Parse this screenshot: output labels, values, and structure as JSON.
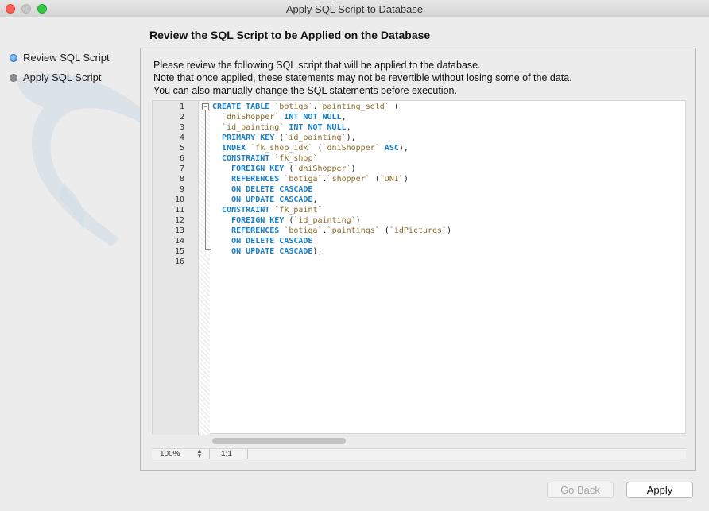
{
  "window": {
    "title": "Apply SQL Script to Database"
  },
  "steps": [
    {
      "label": "Review SQL Script",
      "active": true
    },
    {
      "label": "Apply SQL Script",
      "active": false
    }
  ],
  "heading": "Review the SQL Script to be Applied on the Database",
  "description": [
    "Please review the following SQL script that will be applied to the database.",
    "Note that once applied, these statements may not be revertible without losing some of the data.",
    "You can also manually change the SQL statements before execution."
  ],
  "editor": {
    "line_numbers": [
      "1",
      "2",
      "3",
      "4",
      "5",
      "6",
      "7",
      "8",
      "9",
      "10",
      "11",
      "12",
      "13",
      "14",
      "15",
      "16"
    ],
    "code_lines": [
      [
        {
          "t": "kw",
          "v": "CREATE TABLE "
        },
        {
          "t": "id",
          "v": "`botiga`"
        },
        {
          "t": "p",
          "v": "."
        },
        {
          "t": "id",
          "v": "`painting_sold`"
        },
        {
          "t": "p",
          "v": " ("
        }
      ],
      [
        {
          "t": "p",
          "v": "  "
        },
        {
          "t": "id",
          "v": "`dniShopper`"
        },
        {
          "t": "p",
          "v": " "
        },
        {
          "t": "kw",
          "v": "INT NOT NULL"
        },
        {
          "t": "p",
          "v": ","
        }
      ],
      [
        {
          "t": "p",
          "v": "  "
        },
        {
          "t": "id",
          "v": "`id_painting`"
        },
        {
          "t": "p",
          "v": " "
        },
        {
          "t": "kw",
          "v": "INT NOT NULL"
        },
        {
          "t": "p",
          "v": ","
        }
      ],
      [
        {
          "t": "p",
          "v": "  "
        },
        {
          "t": "kw",
          "v": "PRIMARY KEY"
        },
        {
          "t": "p",
          "v": " ("
        },
        {
          "t": "id",
          "v": "`id_painting`"
        },
        {
          "t": "p",
          "v": "),"
        }
      ],
      [
        {
          "t": "p",
          "v": "  "
        },
        {
          "t": "kw",
          "v": "INDEX"
        },
        {
          "t": "p",
          "v": " "
        },
        {
          "t": "id",
          "v": "`fk_shop_idx`"
        },
        {
          "t": "p",
          "v": " ("
        },
        {
          "t": "id",
          "v": "`dniShopper`"
        },
        {
          "t": "p",
          "v": " "
        },
        {
          "t": "kw",
          "v": "ASC"
        },
        {
          "t": "p",
          "v": "),"
        }
      ],
      [
        {
          "t": "p",
          "v": "  "
        },
        {
          "t": "kw",
          "v": "CONSTRAINT"
        },
        {
          "t": "p",
          "v": " "
        },
        {
          "t": "id",
          "v": "`fk_shop`"
        }
      ],
      [
        {
          "t": "p",
          "v": "    "
        },
        {
          "t": "kw",
          "v": "FOREIGN KEY"
        },
        {
          "t": "p",
          "v": " ("
        },
        {
          "t": "id",
          "v": "`dniShopper`"
        },
        {
          "t": "p",
          "v": ")"
        }
      ],
      [
        {
          "t": "p",
          "v": "    "
        },
        {
          "t": "kw",
          "v": "REFERENCES"
        },
        {
          "t": "p",
          "v": " "
        },
        {
          "t": "id",
          "v": "`botiga`"
        },
        {
          "t": "p",
          "v": "."
        },
        {
          "t": "id",
          "v": "`shopper`"
        },
        {
          "t": "p",
          "v": " ("
        },
        {
          "t": "id",
          "v": "`DNI`"
        },
        {
          "t": "p",
          "v": ")"
        }
      ],
      [
        {
          "t": "p",
          "v": "    "
        },
        {
          "t": "kw",
          "v": "ON DELETE CASCADE"
        }
      ],
      [
        {
          "t": "p",
          "v": "    "
        },
        {
          "t": "kw",
          "v": "ON UPDATE CASCADE"
        },
        {
          "t": "p",
          "v": ","
        }
      ],
      [
        {
          "t": "p",
          "v": "  "
        },
        {
          "t": "kw",
          "v": "CONSTRAINT"
        },
        {
          "t": "p",
          "v": " "
        },
        {
          "t": "id",
          "v": "`fk_paint`"
        }
      ],
      [
        {
          "t": "p",
          "v": "    "
        },
        {
          "t": "kw",
          "v": "FOREIGN KEY"
        },
        {
          "t": "p",
          "v": " ("
        },
        {
          "t": "id",
          "v": "`id_painting`"
        },
        {
          "t": "p",
          "v": ")"
        }
      ],
      [
        {
          "t": "p",
          "v": "    "
        },
        {
          "t": "kw",
          "v": "REFERENCES"
        },
        {
          "t": "p",
          "v": " "
        },
        {
          "t": "id",
          "v": "`botiga`"
        },
        {
          "t": "p",
          "v": "."
        },
        {
          "t": "id",
          "v": "`paintings`"
        },
        {
          "t": "p",
          "v": " ("
        },
        {
          "t": "id",
          "v": "`idPictures`"
        },
        {
          "t": "p",
          "v": ")"
        }
      ],
      [
        {
          "t": "p",
          "v": "    "
        },
        {
          "t": "kw",
          "v": "ON DELETE CASCADE"
        }
      ],
      [
        {
          "t": "p",
          "v": "    "
        },
        {
          "t": "kw",
          "v": "ON UPDATE CASCADE"
        },
        {
          "t": "p",
          "v": ");"
        }
      ],
      []
    ],
    "zoom": "100%",
    "cursor_position": "1:1"
  },
  "buttons": {
    "back": "Go Back",
    "apply": "Apply"
  },
  "colors": {
    "keyword": "#1a80c8",
    "identifier": "#8a6a2a",
    "active_step": "#2f7fd8"
  }
}
